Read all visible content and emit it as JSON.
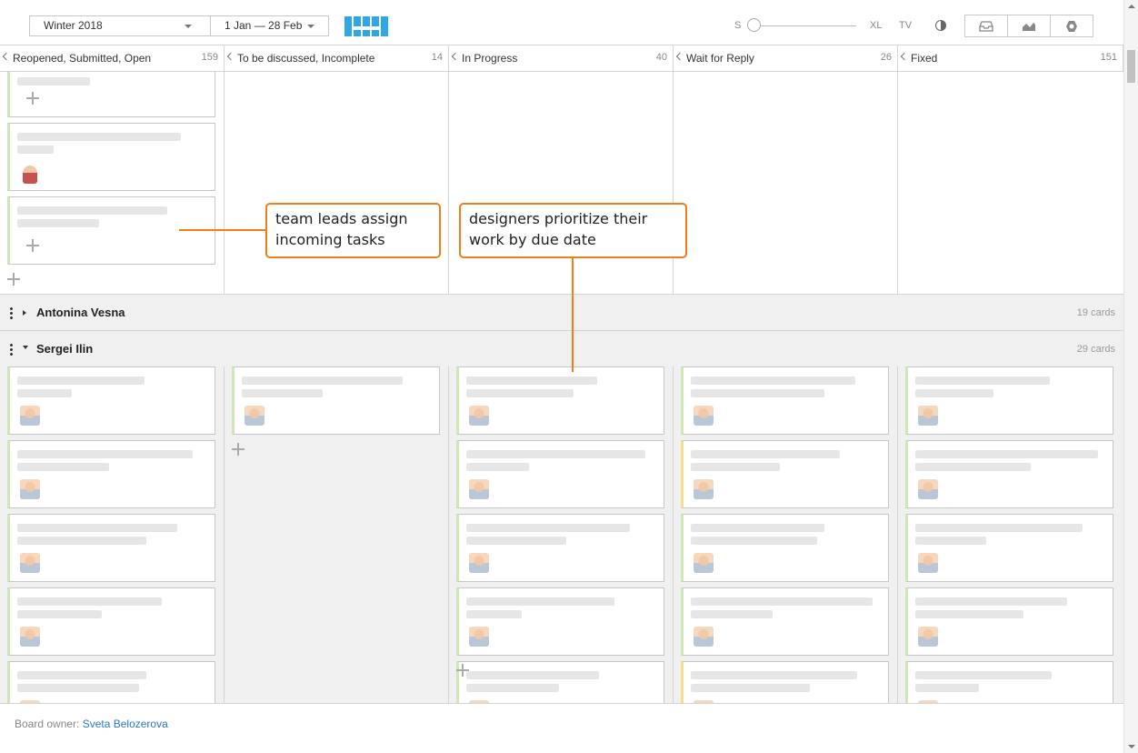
{
  "toolbar": {
    "period": "Winter 2018",
    "date_range": "1 Jan — 28 Feb",
    "size_min": "S",
    "size_max": "XL",
    "tv": "TV",
    "size_level": 0.0,
    "icons": [
      "contrast-icon",
      "inbox-icon",
      "chart-icon",
      "settings-icon"
    ]
  },
  "columns": [
    {
      "title": "Reopened, Submitted, Open",
      "count": "159"
    },
    {
      "title": "To be discussed, Incomplete",
      "count": "14"
    },
    {
      "title": "In Progress",
      "count": "40"
    },
    {
      "title": "Wait for Reply",
      "count": "26"
    },
    {
      "title": "Fixed",
      "count": "151"
    }
  ],
  "swimlanes": [
    {
      "name": "Antonina Vesna",
      "cards": "19 cards",
      "expanded": false
    },
    {
      "name": "Sergei Ilin",
      "cards": "29 cards",
      "expanded": true
    }
  ],
  "annotations": {
    "left": "team leads assign incoming tasks",
    "right": "designers prioritize their work by due date"
  },
  "footer": {
    "label": "Board owner:",
    "owner": "Sveta Belozerova"
  },
  "colors": {
    "accent": "#2ea6e8",
    "callout": "#f07e1a",
    "card_green": "#cfe6b7",
    "card_yellow": "#f3df8a",
    "link": "#2a7bc0"
  }
}
